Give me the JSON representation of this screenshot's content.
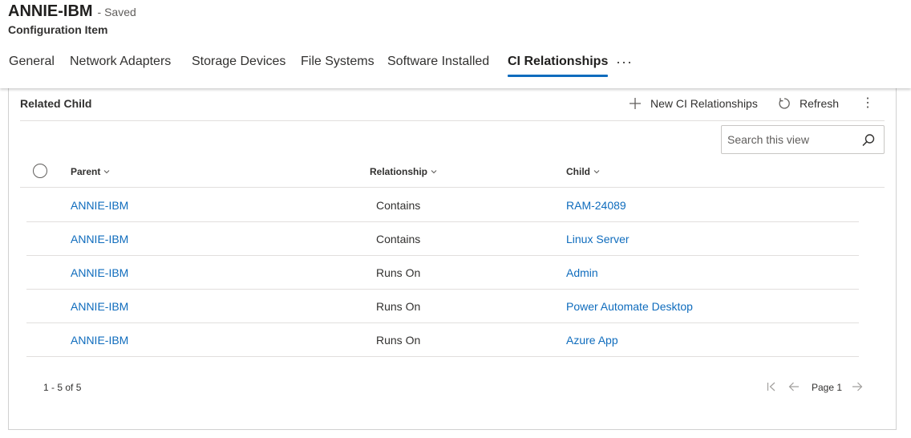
{
  "header": {
    "record_title": "ANNIE-IBM",
    "saved_status": "- Saved",
    "entity_name": "Configuration Item"
  },
  "tabs": [
    {
      "label": "General"
    },
    {
      "label": "Network Adapters"
    },
    {
      "label": "Storage Devices"
    },
    {
      "label": "File Systems"
    },
    {
      "label": "Software Installed"
    },
    {
      "label": "CI Relationships",
      "active": true
    }
  ],
  "tabs_more": "···",
  "section": {
    "title": "Related Child",
    "commands": {
      "new_label": "New CI Relationships",
      "refresh_label": "Refresh"
    },
    "search": {
      "placeholder": "Search this view",
      "value": ""
    }
  },
  "grid": {
    "columns": {
      "parent": "Parent",
      "relationship": "Relationship",
      "child": "Child"
    },
    "rows": [
      {
        "parent": "ANNIE-IBM",
        "relationship": "Contains",
        "child": "RAM-24089"
      },
      {
        "parent": "ANNIE-IBM",
        "relationship": "Contains",
        "child": "Linux Server"
      },
      {
        "parent": "ANNIE-IBM",
        "relationship": "Runs On",
        "child": "Admin"
      },
      {
        "parent": "ANNIE-IBM",
        "relationship": "Runs On",
        "child": "Power Automate Desktop"
      },
      {
        "parent": "ANNIE-IBM",
        "relationship": "Runs On",
        "child": "Azure App"
      }
    ]
  },
  "footer": {
    "record_count": "1 - 5 of 5",
    "page_label": "Page 1"
  },
  "colors": {
    "accent": "#0f6cbd",
    "text": "#323130",
    "border": "#e1dfdd"
  },
  "icons": {
    "new": "plus-icon",
    "refresh": "refresh-icon",
    "more": "more-vertical-icon",
    "search": "search-icon",
    "first_page": "first-page-icon",
    "prev_page": "arrow-left-icon",
    "next_page": "arrow-right-icon"
  }
}
